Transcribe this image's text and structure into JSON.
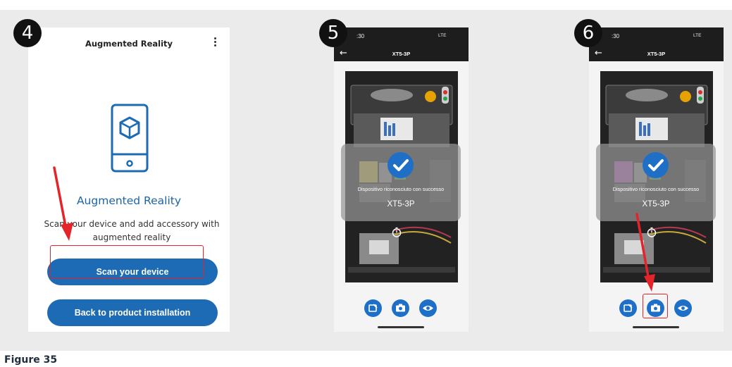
{
  "caption": "Figure 35",
  "colors": {
    "accent": "#1d6ab5",
    "highlight": "#e3242b",
    "success": "#1f6fc6"
  },
  "steps": [
    {
      "number": "4",
      "screen": {
        "header_title": "Augmented Reality",
        "menu_icon": "kebab-menu-icon",
        "hero_icon": "ar-phone-cube-icon",
        "heading": "Augmented Reality",
        "description": "Scan your device and add accessory with augmented reality",
        "primary_button": "Scan your device",
        "secondary_button": "Back to product installation"
      }
    },
    {
      "number": "5",
      "screen": {
        "time": ":30",
        "network": "LTE",
        "title": "XT5-3P",
        "success_message": "Dispositivo riconosciuto con successo",
        "device_model": "XT5-3P",
        "buttons": [
          "edit-icon",
          "camera-icon",
          "eye-icon"
        ]
      }
    },
    {
      "number": "6",
      "screen": {
        "time": ":30",
        "network": "LTE",
        "title": "XT5-3P",
        "success_message": "Dispositivo riconosciuto con successo",
        "device_model": "XT5-3P",
        "buttons": [
          "edit-icon",
          "camera-icon",
          "eye-icon"
        ]
      }
    }
  ]
}
